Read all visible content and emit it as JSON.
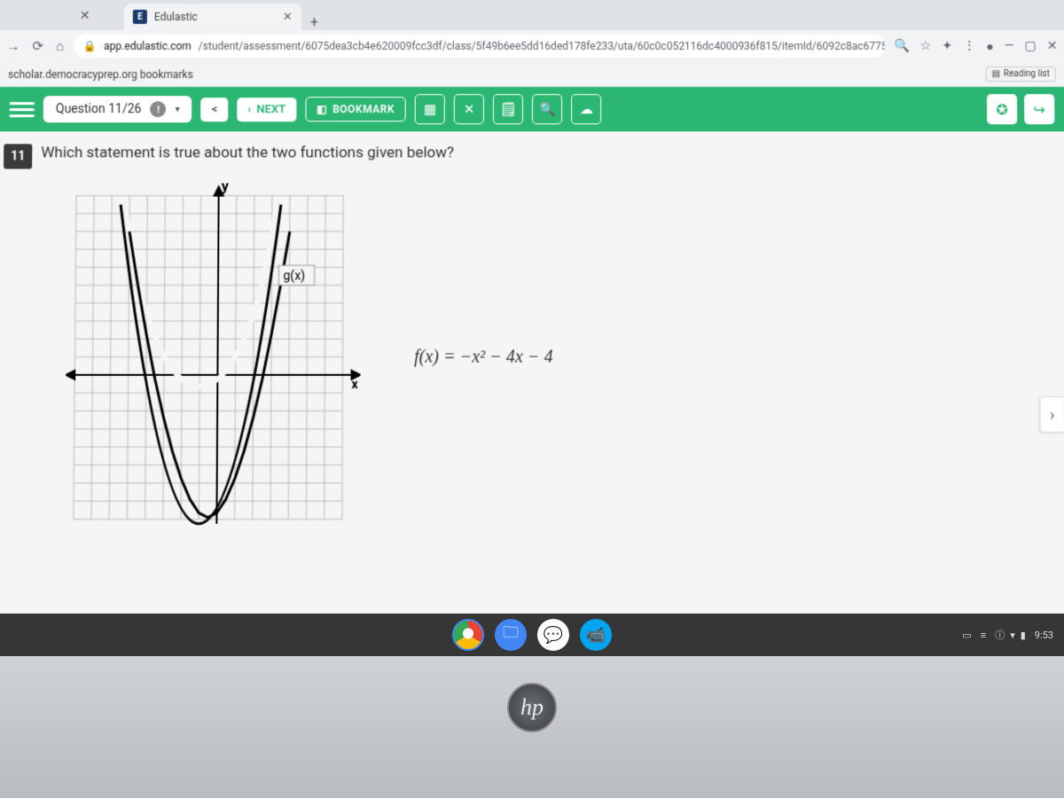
{
  "browser": {
    "tab_title": "Edulastic",
    "tab_favicon": "E",
    "url_host": "app.edulastic.com",
    "url_path": "/student/assessment/6075dea3cb4e620009fcc3df/class/5f49b6ee5dd16ded178fe233/uta/60c0c052116dc4000936f815/itemId/6092c8ac6775a...",
    "bookmark_item": "scholar.democracyprep.org bookmarks",
    "reading_list": "Reading list"
  },
  "toolbar": {
    "question_label": "Question 11/26",
    "info_badge": "!",
    "prev": "<",
    "next_label": "NEXT",
    "bookmark_label": "BOOKMARK"
  },
  "question": {
    "number": "11",
    "text": "Which statement is true about the two functions given below?",
    "graph": {
      "y_label": "y",
      "x_label": "x",
      "curve_label": "g(x)"
    },
    "formula": "f(x) = −x² − 4x − 4"
  },
  "shelf": {
    "time": "9:53"
  },
  "laptop": {
    "logo": "hp"
  },
  "chart_data": {
    "type": "line",
    "title": "g(x)",
    "xlabel": "x",
    "ylabel": "y",
    "note": "Upward-opening parabola, vertex approximately at (-1, -8), crossing x-axis near x ≈ -4 and x ≈ 2, y-axis grid from roughly -8 to 10, x-axis grid from roughly -8 to 8",
    "series": [
      {
        "name": "g(x)",
        "x": [
          -5,
          -4,
          -3,
          -2,
          -1,
          0,
          1,
          2,
          3
        ],
        "values": [
          8,
          1,
          -4,
          -7,
          -8,
          -7,
          -4,
          1,
          8
        ]
      }
    ],
    "xlim": [
      -8,
      8
    ],
    "ylim": [
      -9,
      10
    ]
  }
}
